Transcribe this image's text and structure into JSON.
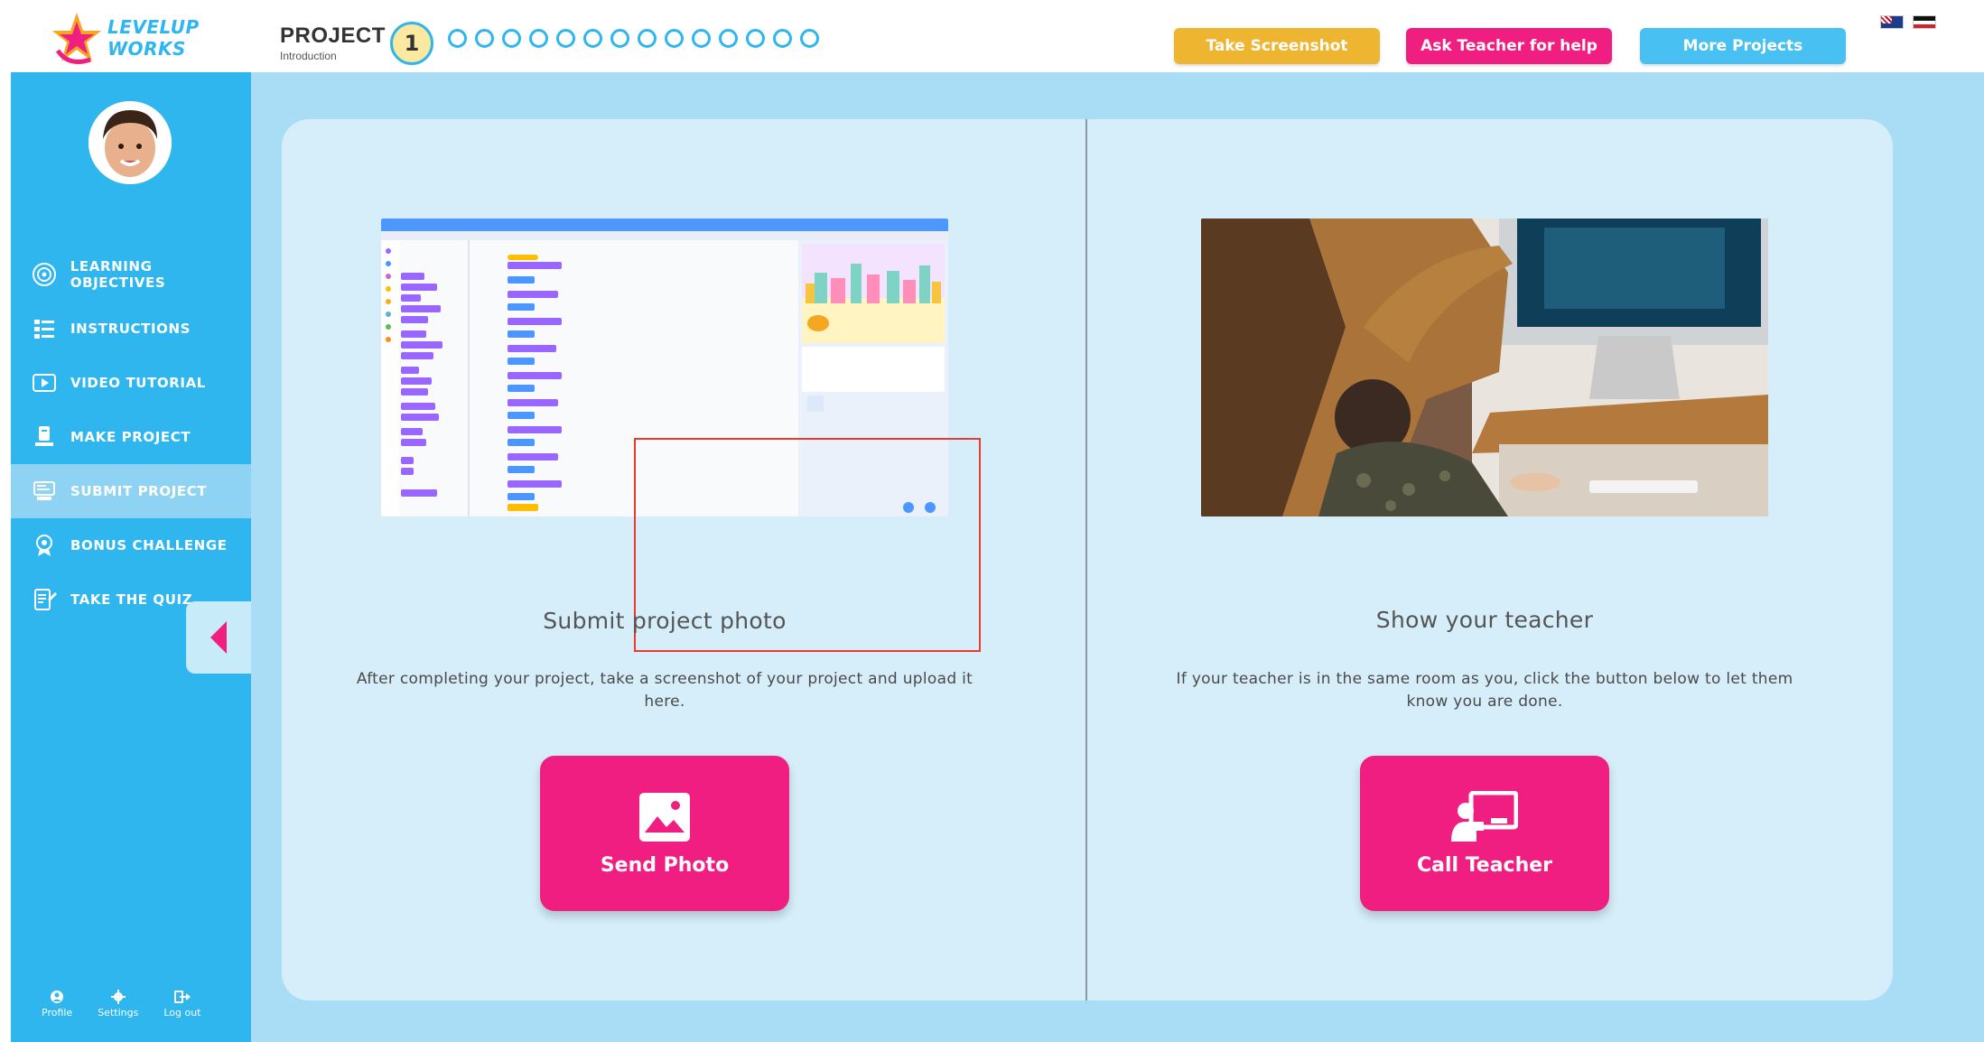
{
  "header": {
    "logo_line1": "LEVELUP",
    "logo_line2": "WORKS",
    "project_title": "PROJECT",
    "project_subtitle": "Introduction",
    "current_step": "1",
    "step_count_remaining": 14,
    "buttons": {
      "take_screenshot": "Take Screenshot",
      "ask_teacher": "Ask Teacher for help",
      "more_projects": "More Projects"
    },
    "flags": [
      "australia-flag-icon",
      "new-zealand-flag-icon"
    ]
  },
  "sidebar": {
    "items": [
      {
        "label": "LEARNING OBJECTIVES",
        "icon": "target-icon"
      },
      {
        "label": "INSTRUCTIONS",
        "icon": "list-icon"
      },
      {
        "label": "VIDEO TUTORIAL",
        "icon": "play-icon"
      },
      {
        "label": "MAKE PROJECT",
        "icon": "tools-icon"
      },
      {
        "label": "SUBMIT PROJECT",
        "icon": "submit-icon",
        "active": true
      },
      {
        "label": "BONUS CHALLENGE",
        "icon": "badge-icon"
      },
      {
        "label": "TAKE THE QUIZ",
        "icon": "quiz-icon"
      }
    ],
    "footer": {
      "profile": "Profile",
      "settings": "Settings",
      "logout": "Log out"
    }
  },
  "main": {
    "left": {
      "title": "Submit project photo",
      "description": "After completing your project, take a screenshot of your project and upload it here.",
      "button": "Send Photo"
    },
    "right": {
      "title": "Show your teacher",
      "description": "If your teacher is in the same room as you, click the button below to let them know you are done.",
      "button": "Call Teacher"
    }
  },
  "colors": {
    "brand_blue": "#2fb6ee",
    "accent_pink": "#f01e80",
    "screenshot_yellow": "#eeb531",
    "more_projects_blue": "#49c0f2",
    "main_bg": "#a9dcf5",
    "card_bg": "#d5eef9"
  }
}
